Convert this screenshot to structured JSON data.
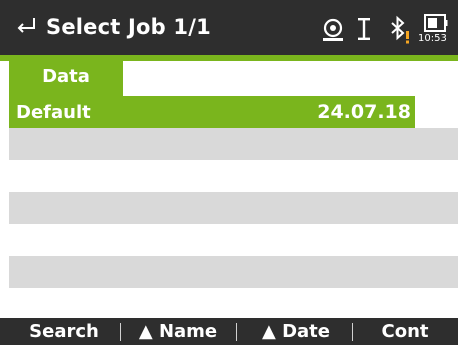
{
  "header": {
    "title": "Select Job 1/1",
    "back_icon": "return-arrow-icon",
    "status_icons": [
      "prism-target-icon",
      "ir-text-cursor-icon",
      "bluetooth-warning-icon",
      "battery-icon"
    ],
    "time": "10:53",
    "warning_color": "#f5a623"
  },
  "tabs": [
    {
      "label": "Data",
      "active": true
    }
  ],
  "jobs": {
    "rows": [
      {
        "name": "Default",
        "date": "24.07.18",
        "selected": true
      }
    ]
  },
  "softkeys": {
    "f1": "Search",
    "f2": "▲ Name",
    "f3": "▲ Date",
    "f4": "Cont"
  },
  "colors": {
    "accent": "#7ab51d",
    "bar": "#2e2e2e",
    "row_gray": "#d9d9d9"
  }
}
